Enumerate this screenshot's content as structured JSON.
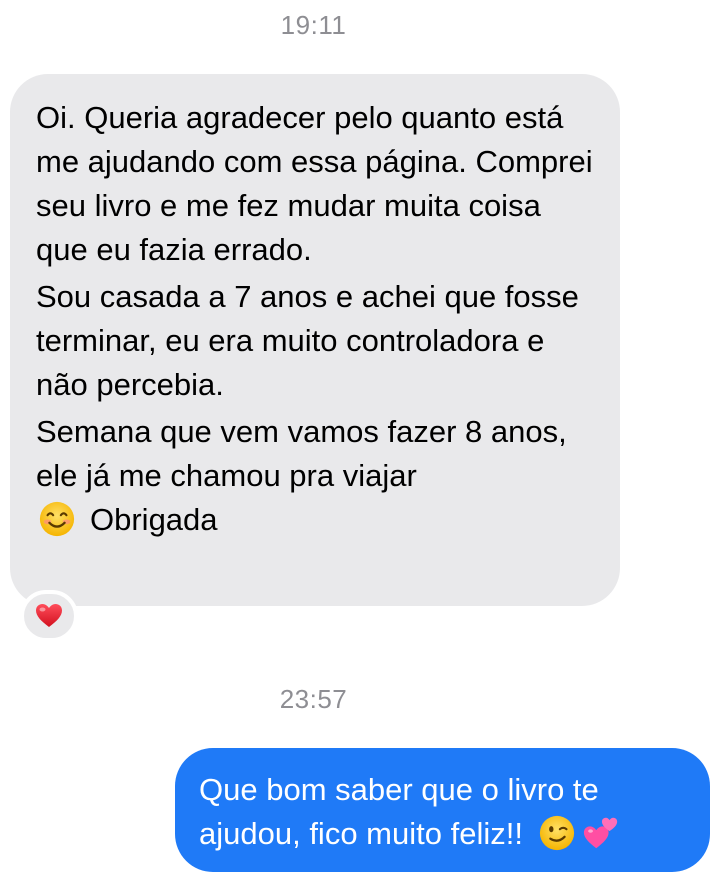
{
  "conversation": {
    "timestamp_1": "19:11",
    "incoming_message": {
      "paragraph_1": "Oi. Queria agradecer pelo quanto está me ajudando com essa página. Comprei seu livro e me fez mudar muita coisa que eu fazia errado.",
      "paragraph_2": "Sou casada a 7 anos e achei que fosse terminar, eu era muito controladora e não percebia.",
      "paragraph_3_before_emoji": "Semana que vem vamos fazer 8 anos, ele já me chamou pra viajar",
      "paragraph_3_emoji": "smiling-face-icon",
      "paragraph_3_after_emoji": "Obrigada",
      "reaction": "heart-icon"
    },
    "timestamp_2": "23:57",
    "outgoing_message": {
      "text": "Que bom saber que o livro te ajudou, fico muito feliz!!",
      "emoji_1": "winking-face-icon",
      "emoji_2": "two-hearts-icon"
    }
  },
  "colors": {
    "incoming_bubble": "#e9e9eb",
    "outgoing_bubble": "#1f7af7",
    "timestamp": "#8e8e93",
    "heart": "#e8232f"
  }
}
